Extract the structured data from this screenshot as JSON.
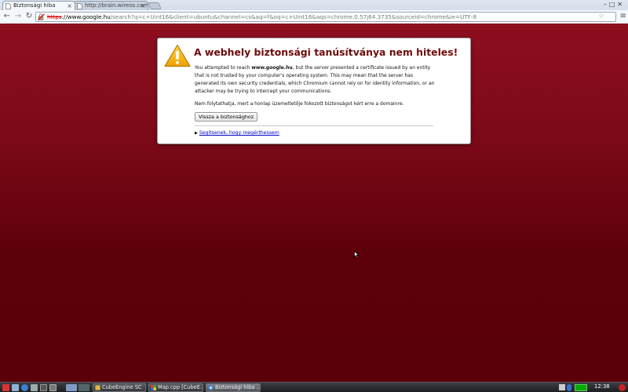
{
  "browser": {
    "tabs": [
      {
        "label": "Biztonsági hiba",
        "active": true
      },
      {
        "label": "http://brain.wireos.com",
        "active": false
      }
    ],
    "url": {
      "protocol": "https",
      "separator": "://",
      "host": "www.google.hu",
      "path": "/search?q=c+Uint16&client=ubuntu&channel=cs&aq=f&oq=c+Uint16&aqs=chrome.0.57j64.3735&sourceid=chrome&ie=UTF-8"
    }
  },
  "page": {
    "title": "A webhely biztonsági tanúsítványa nem hiteles!",
    "para1_prefix": "You attempted to reach ",
    "para1_host": "www.google.hu",
    "para1_rest": ", but the server presented a certificate issued by an entity that is not trusted by your computer's operating system. This may mean that the server has generated its own security credentials, which Chromium cannot rely on for identity information, or an attacker may be trying to intercept your communications.",
    "para2": "Nem folytathatja, mert a honlap üzemeltetője fokozott biztonságot kért erre a domainre.",
    "back_button": "Vissza a biztonsághoz",
    "help_link": "Segítsenek, hogy megérthessem"
  },
  "taskbar": {
    "tasks": [
      {
        "label": "CubeEngine SC"
      },
      {
        "label": "Map.cpp [CubeE..."
      },
      {
        "label": "Biztonsági hiba ..."
      }
    ],
    "clock": "12:38"
  },
  "colors": {
    "page_bg_top": "#8e0f1f",
    "page_bg_bottom": "#5a0008",
    "title_color": "#6d0b0b",
    "link_color": "#0000cc"
  }
}
